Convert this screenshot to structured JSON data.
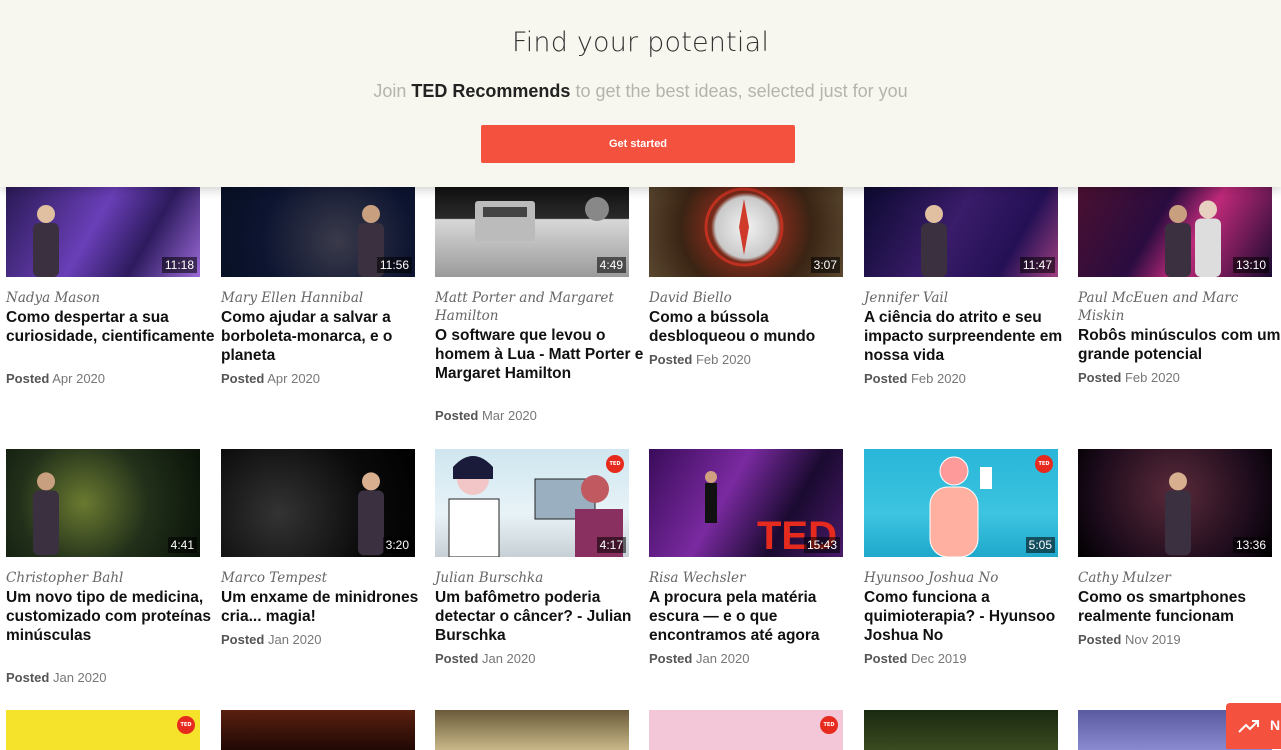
{
  "banner": {
    "heading": "Find your potential",
    "sub_before": "Join",
    "sub_brand": "TED Recommends",
    "sub_after": "to get the best ideas, selected just for you",
    "cta": "Get started"
  },
  "posted_label": "Posted",
  "ted_badge": "TED",
  "talks": [
    {
      "speaker": "Nadya Mason",
      "title": "Como despertar a sua curiosidade, cientificamente",
      "date": "Apr 2020",
      "duration": "11:18"
    },
    {
      "speaker": "Mary Ellen Hannibal",
      "title": "Como ajudar a salvar a borboleta-monarca, e o planeta",
      "date": "Apr 2020",
      "duration": "11:56"
    },
    {
      "speaker": "Matt Porter and Margaret Hamilton",
      "title": "O software que levou o homem à Lua - Matt Porter e Margaret Hamilton",
      "date": "Mar 2020",
      "duration": "4:49"
    },
    {
      "speaker": "David Biello",
      "title": "Como a bússola desbloqueou o mundo",
      "date": "Feb 2020",
      "duration": "3:07"
    },
    {
      "speaker": "Jennifer Vail",
      "title": "A ciência do atrito e seu impacto surpreendente em nossa vida",
      "date": "Feb 2020",
      "duration": "11:47"
    },
    {
      "speaker": "Paul McEuen and Marc Miskin",
      "title": "Robôs minúsculos com um grande potencial",
      "date": "Feb 2020",
      "duration": "13:10"
    },
    {
      "speaker": "Christopher Bahl",
      "title": "Um novo tipo de medicina, customizado com proteínas minúsculas",
      "date": "Jan 2020",
      "duration": "4:41"
    },
    {
      "speaker": "Marco Tempest",
      "title": "Um enxame de minidrones cria... magia!",
      "date": "Jan 2020",
      "duration": "3:20"
    },
    {
      "speaker": "Julian Burschka",
      "title": "Um bafômetro poderia detectar o câncer? - Julian Burschka",
      "date": "Jan 2020",
      "duration": "4:17"
    },
    {
      "speaker": "Risa Wechsler",
      "title": "A procura pela matéria escura — e o que encontramos até agora",
      "date": "Jan 2020",
      "duration": "15:43"
    },
    {
      "speaker": "Hyunsoo Joshua No",
      "title": "Como funciona a quimioterapia? - Hyunsoo Joshua No",
      "date": "Dec 2019",
      "duration": "5:05"
    },
    {
      "speaker": "Cathy Mulzer",
      "title": "Como os smartphones realmente funcionam",
      "date": "Nov 2019",
      "duration": "13:36"
    }
  ],
  "trending": {
    "label": "N",
    "icon": "trending-up-icon"
  },
  "colors": {
    "accent": "#f4513f",
    "banner_bg": "#f8f7ef",
    "ted_red": "#e62b1e"
  }
}
